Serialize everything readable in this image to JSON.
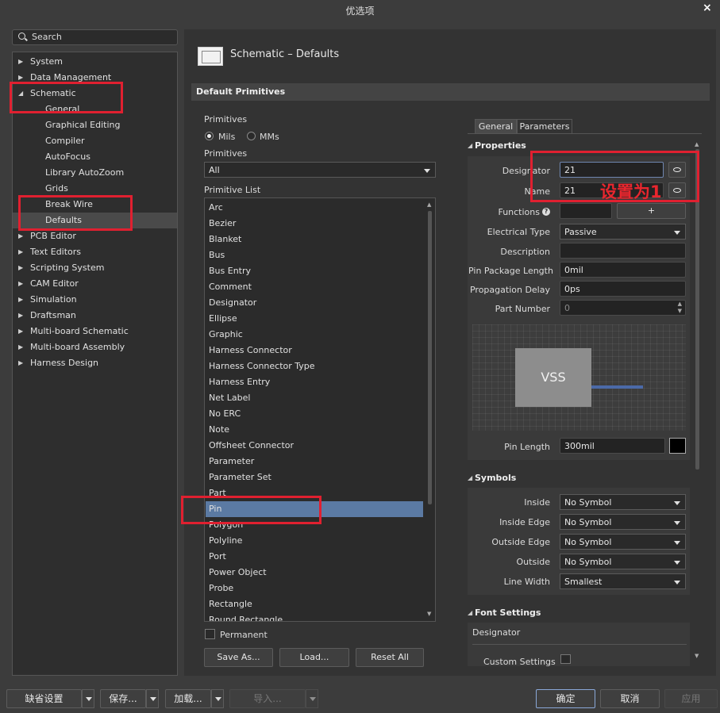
{
  "window": {
    "title": "优选项"
  },
  "search": {
    "label": "Search"
  },
  "tree": {
    "items": [
      {
        "label": "System"
      },
      {
        "label": "Data Management"
      },
      {
        "label": "Schematic"
      },
      {
        "label": "General"
      },
      {
        "label": "Graphical Editing"
      },
      {
        "label": "Compiler"
      },
      {
        "label": "AutoFocus"
      },
      {
        "label": "Library AutoZoom"
      },
      {
        "label": "Grids"
      },
      {
        "label": "Break Wire"
      },
      {
        "label": "Defaults"
      },
      {
        "label": "PCB Editor"
      },
      {
        "label": "Text Editors"
      },
      {
        "label": "Scripting System"
      },
      {
        "label": "CAM Editor"
      },
      {
        "label": "Simulation"
      },
      {
        "label": "Draftsman"
      },
      {
        "label": "Multi-board Schematic"
      },
      {
        "label": "Multi-board Assembly"
      },
      {
        "label": "Harness Design"
      }
    ]
  },
  "header": {
    "title": "Schematic – Defaults"
  },
  "section": {
    "title": "Default Primitives"
  },
  "left": {
    "primitives_label": "Primitives",
    "units": {
      "mils": "Mils",
      "mms": "MMs"
    },
    "primitives_label2": "Primitives",
    "filter_value": "All",
    "list_label": "Primitive List",
    "list": [
      "Arc",
      "Bezier",
      "Blanket",
      "Bus",
      "Bus Entry",
      "Comment",
      "Designator",
      "Ellipse",
      "Graphic",
      "Harness Connector",
      "Harness Connector Type",
      "Harness Entry",
      "Net Label",
      "No ERC",
      "Note",
      "Offsheet Connector",
      "Parameter",
      "Parameter Set",
      "Part",
      "Pin",
      "Polygon",
      "Polyline",
      "Port",
      "Power Object",
      "Probe",
      "Rectangle",
      "Round Rectangle"
    ],
    "permanent_label": "Permanent",
    "buttons": {
      "save_as": "Save As...",
      "load": "Load...",
      "reset_all": "Reset All"
    }
  },
  "right": {
    "tabs": {
      "general": "General",
      "parameters": "Parameters"
    },
    "properties": {
      "title": "Properties",
      "designator_label": "Designator",
      "designator_value": "21",
      "name_label": "Name",
      "name_value": "21",
      "functions_label": "Functions",
      "functions_add": "+",
      "electrical_type_label": "Electrical Type",
      "electrical_type_value": "Passive",
      "description_label": "Description",
      "description_value": "",
      "pin_package_length_label": "Pin Package Length",
      "pin_package_length_value": "0mil",
      "propagation_delay_label": "Propagation Delay",
      "propagation_delay_value": "0ps",
      "part_number_label": "Part Number",
      "part_number_value": "0",
      "preview_text": "VSS",
      "pin_length_label": "Pin Length",
      "pin_length_value": "300mil"
    },
    "symbols": {
      "title": "Symbols",
      "inside_label": "Inside",
      "inside_value": "No Symbol",
      "inside_edge_label": "Inside Edge",
      "inside_edge_value": "No Symbol",
      "outside_edge_label": "Outside Edge",
      "outside_edge_value": "No Symbol",
      "outside_label": "Outside",
      "outside_value": "No Symbol",
      "line_width_label": "Line Width",
      "line_width_value": "Smallest"
    },
    "font_settings": {
      "title": "Font Settings",
      "designator_label": "Designator",
      "custom_settings_label": "Custom Settings"
    }
  },
  "annotation": {
    "text": "设置为1",
    "color": "#e02030"
  },
  "bottom": {
    "defaults": "缺省设置",
    "save": "保存...",
    "load": "加载...",
    "import": "导入...",
    "ok": "确定",
    "cancel": "取消",
    "apply": "应用"
  }
}
